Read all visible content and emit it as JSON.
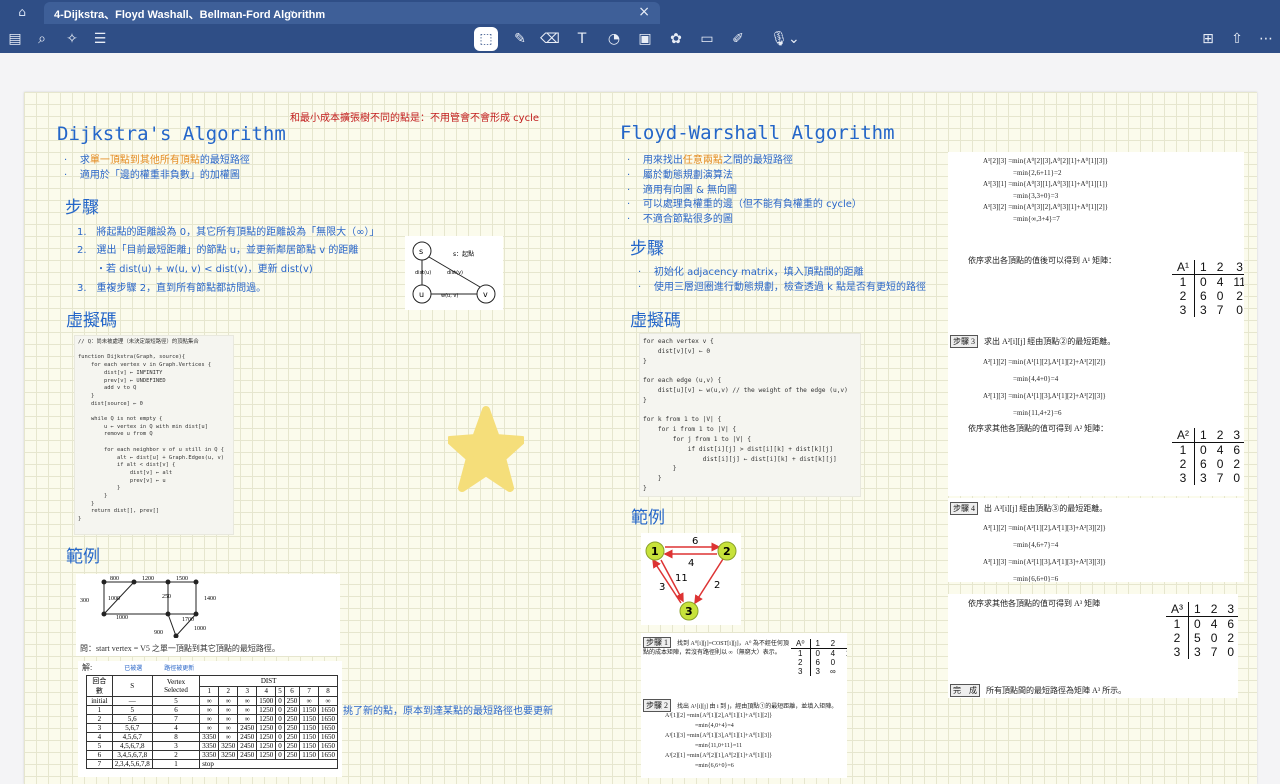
{
  "tab": {
    "title": "4-Dijkstra、Floyd Washall、Bellman-Ford Algorithm"
  },
  "toolbar": {
    "left": [
      "sidebar-icon",
      "search-icon",
      "sparkle-icon",
      "notes-icon"
    ],
    "center": [
      "lasso-icon",
      "pen-icon",
      "eraser-icon",
      "text-icon",
      "shape-icon",
      "image-icon",
      "sticker-icon",
      "sticky-note-icon",
      "highlighter-icon",
      "microphone-icon"
    ],
    "right": [
      "add-page-icon",
      "share-icon",
      "more-icon"
    ]
  },
  "note": {
    "top_red": "和最小成本擴張樹不同的點是：不用管會不會形成 cycle"
  },
  "dijkstra": {
    "title": "Dijkstra's Algorithm",
    "b1_pre": "求",
    "b1_hl": "單一頂點到其他所有頂點",
    "b1_post": "的最短路徑",
    "b2": "適用於「邊的權重非負數」的加權圖",
    "steps_title": "步驟",
    "s1": "1.　將起點的距離設為 0，其它所有頂點的距離設為「無限大（∞）」",
    "s2": "2.　選出「目前最短距離」的節點 u，並更新鄰居節點 v 的距離",
    "s2b": "・若 dist(u) + w(u, v) < dist(v)，更新 dist(v)",
    "s3": "3.　重複步驟 2，直到所有節點都訪問過。",
    "diagram": {
      "s": "s",
      "start": "s：起點",
      "distu": "dist(u)",
      "distv": "dist(v)",
      "u": "u",
      "v": "v",
      "w": "w(u, v)"
    },
    "pseudo_title": "虛擬碼",
    "code": "// Q：尚未被處理（未決定最短路徑）的頂點集合\n\nfunction Dijkstra(Graph, source){\n    for each vertex v in Graph.Vertices {\n        dist[v] ← INFINITY\n        prev[v] ← UNDEFINED\n        add v to Q\n    }\n    dist[source] ← 0\n\n    while Q is not empty {\n        u ← vertex in Q with min dist[u]\n        remove u from Q\n\n        for each neighbor v of u still in Q {\n            alt ← dist[u] + Graph.Edges(u, v)\n            if alt < dist[v] {\n                dist[v] ← alt\n                prev[v] ← u\n            }\n        }\n    }\n    return dist[], prev[]\n}",
    "example_title": "範例",
    "example_question": "問：start vertex = V5 之單一頂點到其它頂點的最短路徑。",
    "answer": "解:",
    "answer_tag1": "已被選",
    "answer_tag2": "路徑被更新",
    "side_note": "挑了新的點，原本到達某點的最短路徑也要更新",
    "table_headers": [
      "回合數",
      "S",
      "Vertex Selected",
      "DIST"
    ],
    "dist_cols": [
      "1",
      "2",
      "3",
      "4",
      "5",
      "6",
      "7",
      "8"
    ],
    "rows": [
      [
        "initial",
        "—",
        "5",
        "∞",
        "∞",
        "∞",
        "1500",
        "0",
        "250",
        "∞",
        "∞"
      ],
      [
        "1",
        "5",
        "6",
        "∞",
        "∞",
        "∞",
        "1250",
        "0",
        "250",
        "1150",
        "1650"
      ],
      [
        "2",
        "5,6",
        "7",
        "∞",
        "∞",
        "∞",
        "1250",
        "0",
        "250",
        "1150",
        "1650"
      ],
      [
        "3",
        "5,6,7",
        "4",
        "∞",
        "∞",
        "2450",
        "1250",
        "0",
        "250",
        "1150",
        "1650"
      ],
      [
        "4",
        "4,5,6,7",
        "8",
        "3350",
        "∞",
        "2450",
        "1250",
        "0",
        "250",
        "1150",
        "1650"
      ],
      [
        "5",
        "4,5,6,7,8",
        "3",
        "3350",
        "3250",
        "2450",
        "1250",
        "0",
        "250",
        "1150",
        "1650"
      ],
      [
        "6",
        "3,4,5,6,7,8",
        "2",
        "3350",
        "3250",
        "2450",
        "1250",
        "0",
        "250",
        "1150",
        "1650"
      ],
      [
        "7",
        "2,3,4,5,6,7,8",
        "1",
        "stop",
        "",
        "",
        "",
        "",
        "",
        "",
        ""
      ]
    ],
    "graph_weights": [
      "800",
      "1200",
      "1500",
      "300",
      "1000",
      "1000",
      "250",
      "1700",
      "1400",
      "900",
      "1000"
    ]
  },
  "floyd": {
    "title": "Floyd-Warshall Algorithm",
    "b1_pre": "用來找出",
    "b1_hl": "任意兩點",
    "b1_post": "之間的最短路徑",
    "b2": "屬於動態規劃演算法",
    "b3": "適用有向圖 & 無向圖",
    "b4": "可以處理負權重的邊（但不能有負權重的 cycle）",
    "b5": "不適合節點很多的圖",
    "steps_title": "步驟",
    "s1": "初始化 adjacency matrix，填入頂點間的距離",
    "s2": "使用三層迴圈進行動態規劃，檢查透過 k 點是否有更短的路徑",
    "pseudo_title": "虛擬碼",
    "code": "for each vertex v {\n    dist[v][v] ← 0\n}\n\nfor each edge (u,v) {\n    dist[u][v] ← w(u,v) // the weight of the edge (u,v)\n}\n\nfor k from 1 to |V| {\n    for i from 1 to |V| {\n        for j from 1 to |V| {\n            if dist[i][j] > dist[i][k] + dist[k][j]\n                dist[i][j] ← dist[i][k] + dist[k][j]\n        }\n    }\n}",
    "example_title": "範例",
    "graph": {
      "n1": "1",
      "n2": "2",
      "n3": "3",
      "w12": "6",
      "w21": "4",
      "w13": "11",
      "w31": "3",
      "w23": "2"
    },
    "step1_label": "步驟 1",
    "step1_text": "找到 A⁰[i][j]=COST[i][j]，A⁰ 為不經任何頂點的成本矩陣，若沒有路徑則以 ∞（無窮大）表示。",
    "step2_label": "步驟 2",
    "step2_text": "找出 A¹[i][j] 由 i 到 j，經由頂點①的最短距離，並填入矩陣。",
    "step2_eq": [
      "A¹[1][2] =min{A⁰[1][2],A⁰[1][1]+A⁰[1][2]}",
      "=min{4,0+4}=4",
      "A¹[1][3] =min{A⁰[1][3],A⁰[1][1]+A⁰[1][3]}",
      "=min{11,0+11}=11",
      "A¹[2][1] =min{A⁰[2][1],A⁰[2][1]+A⁰[1][1]}",
      "=min{6,6+0}=6"
    ],
    "a0": {
      "name": "A⁰",
      "cols": [
        "1",
        "2",
        "3"
      ],
      "rows": [
        [
          "1",
          "0",
          "4",
          "11"
        ],
        [
          "2",
          "6",
          "0",
          "2"
        ],
        [
          "3",
          "3",
          "∞",
          "0"
        ]
      ]
    },
    "top_eq": [
      "A¹[2][3] =min{A⁰[2][3],A⁰[2][1]+A⁰[1][3]}",
      "=min{2,6+11}=2",
      "A¹[3][1] =min{A⁰[3][1],A⁰[3][1]+A⁰[1][1]}",
      "=min{3,3+0}=3",
      "A¹[3][2] =min{A⁰[3][2],A⁰[3][1]+A⁰[1][2]}",
      "=min{∞,3+4}=7"
    ],
    "a1_text": "依序求出各頂點的值後可以得到 A¹ 矩陣：",
    "a1": {
      "name": "A¹",
      "cols": [
        "1",
        "2",
        "3"
      ],
      "rows": [
        [
          "1",
          "0",
          "4",
          "11"
        ],
        [
          "2",
          "6",
          "0",
          "2"
        ],
        [
          "3",
          "3",
          "7",
          "0"
        ]
      ]
    },
    "step3_label": "步驟 3",
    "step3_text": "求出 A²[i][j] 經由頂點②的最短距離。",
    "step3_eq": [
      "A²[1][2] =min{A¹[1][2],A¹[1][2]+A¹[2][2]}",
      "=min{4,4+0}=4",
      "A²[1][3] =min{A¹[1][3],A¹[1][2]+A¹[2][3]}",
      "=min{11,4+2}=6"
    ],
    "a2_text": "依序求其他各頂點的值可得到 A² 矩陣：",
    "a2": {
      "name": "A²",
      "cols": [
        "1",
        "2",
        "3"
      ],
      "rows": [
        [
          "1",
          "0",
          "4",
          "6"
        ],
        [
          "2",
          "6",
          "0",
          "2"
        ],
        [
          "3",
          "3",
          "7",
          "0"
        ]
      ]
    },
    "step4_label": "步驟 4",
    "step4_text": "出 A³[i][j] 經由頂點③的最短距離。",
    "step4_eq": [
      "A³[1][2] =min{A²[1][2],A²[1][3]+A²[3][2]}",
      "=min{4,6+7}=4",
      "A³[1][3] =min{A²[1][3],A²[1][3]+A²[3][3]}",
      "=min{6,6+0}=6"
    ],
    "a3_text": "依序求其他各頂點的值可得到 A³ 矩陣",
    "a3": {
      "name": "A³",
      "cols": [
        "1",
        "2",
        "3"
      ],
      "rows": [
        [
          "1",
          "0",
          "4",
          "6"
        ],
        [
          "2",
          "5",
          "0",
          "2"
        ],
        [
          "3",
          "3",
          "7",
          "0"
        ]
      ]
    },
    "done_label": "完　成",
    "done_text": "所有頂點間的最短路徑為矩陣 A³ 所示。"
  },
  "colors": {
    "blue": "#2466c9",
    "orange": "#e48a1e",
    "red": "#c21d1d",
    "star": "#f5de7a",
    "header": "#2f4e86"
  }
}
